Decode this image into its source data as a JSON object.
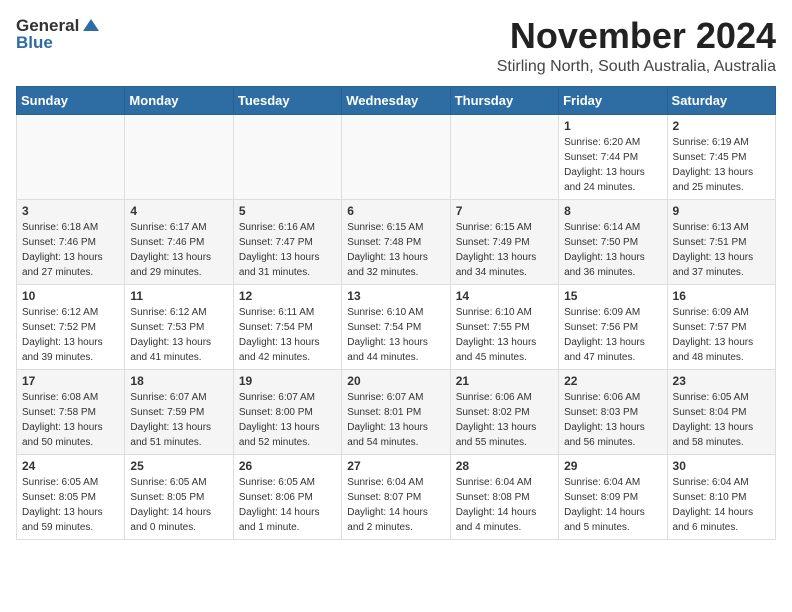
{
  "logo": {
    "general": "General",
    "blue": "Blue"
  },
  "header": {
    "title": "November 2024",
    "subtitle": "Stirling North, South Australia, Australia"
  },
  "weekdays": [
    "Sunday",
    "Monday",
    "Tuesday",
    "Wednesday",
    "Thursday",
    "Friday",
    "Saturday"
  ],
  "weeks": [
    [
      {
        "day": "",
        "info": ""
      },
      {
        "day": "",
        "info": ""
      },
      {
        "day": "",
        "info": ""
      },
      {
        "day": "",
        "info": ""
      },
      {
        "day": "",
        "info": ""
      },
      {
        "day": "1",
        "info": "Sunrise: 6:20 AM\nSunset: 7:44 PM\nDaylight: 13 hours\nand 24 minutes."
      },
      {
        "day": "2",
        "info": "Sunrise: 6:19 AM\nSunset: 7:45 PM\nDaylight: 13 hours\nand 25 minutes."
      }
    ],
    [
      {
        "day": "3",
        "info": "Sunrise: 6:18 AM\nSunset: 7:46 PM\nDaylight: 13 hours\nand 27 minutes."
      },
      {
        "day": "4",
        "info": "Sunrise: 6:17 AM\nSunset: 7:46 PM\nDaylight: 13 hours\nand 29 minutes."
      },
      {
        "day": "5",
        "info": "Sunrise: 6:16 AM\nSunset: 7:47 PM\nDaylight: 13 hours\nand 31 minutes."
      },
      {
        "day": "6",
        "info": "Sunrise: 6:15 AM\nSunset: 7:48 PM\nDaylight: 13 hours\nand 32 minutes."
      },
      {
        "day": "7",
        "info": "Sunrise: 6:15 AM\nSunset: 7:49 PM\nDaylight: 13 hours\nand 34 minutes."
      },
      {
        "day": "8",
        "info": "Sunrise: 6:14 AM\nSunset: 7:50 PM\nDaylight: 13 hours\nand 36 minutes."
      },
      {
        "day": "9",
        "info": "Sunrise: 6:13 AM\nSunset: 7:51 PM\nDaylight: 13 hours\nand 37 minutes."
      }
    ],
    [
      {
        "day": "10",
        "info": "Sunrise: 6:12 AM\nSunset: 7:52 PM\nDaylight: 13 hours\nand 39 minutes."
      },
      {
        "day": "11",
        "info": "Sunrise: 6:12 AM\nSunset: 7:53 PM\nDaylight: 13 hours\nand 41 minutes."
      },
      {
        "day": "12",
        "info": "Sunrise: 6:11 AM\nSunset: 7:54 PM\nDaylight: 13 hours\nand 42 minutes."
      },
      {
        "day": "13",
        "info": "Sunrise: 6:10 AM\nSunset: 7:54 PM\nDaylight: 13 hours\nand 44 minutes."
      },
      {
        "day": "14",
        "info": "Sunrise: 6:10 AM\nSunset: 7:55 PM\nDaylight: 13 hours\nand 45 minutes."
      },
      {
        "day": "15",
        "info": "Sunrise: 6:09 AM\nSunset: 7:56 PM\nDaylight: 13 hours\nand 47 minutes."
      },
      {
        "day": "16",
        "info": "Sunrise: 6:09 AM\nSunset: 7:57 PM\nDaylight: 13 hours\nand 48 minutes."
      }
    ],
    [
      {
        "day": "17",
        "info": "Sunrise: 6:08 AM\nSunset: 7:58 PM\nDaylight: 13 hours\nand 50 minutes."
      },
      {
        "day": "18",
        "info": "Sunrise: 6:07 AM\nSunset: 7:59 PM\nDaylight: 13 hours\nand 51 minutes."
      },
      {
        "day": "19",
        "info": "Sunrise: 6:07 AM\nSunset: 8:00 PM\nDaylight: 13 hours\nand 52 minutes."
      },
      {
        "day": "20",
        "info": "Sunrise: 6:07 AM\nSunset: 8:01 PM\nDaylight: 13 hours\nand 54 minutes."
      },
      {
        "day": "21",
        "info": "Sunrise: 6:06 AM\nSunset: 8:02 PM\nDaylight: 13 hours\nand 55 minutes."
      },
      {
        "day": "22",
        "info": "Sunrise: 6:06 AM\nSunset: 8:03 PM\nDaylight: 13 hours\nand 56 minutes."
      },
      {
        "day": "23",
        "info": "Sunrise: 6:05 AM\nSunset: 8:04 PM\nDaylight: 13 hours\nand 58 minutes."
      }
    ],
    [
      {
        "day": "24",
        "info": "Sunrise: 6:05 AM\nSunset: 8:05 PM\nDaylight: 13 hours\nand 59 minutes."
      },
      {
        "day": "25",
        "info": "Sunrise: 6:05 AM\nSunset: 8:05 PM\nDaylight: 14 hours\nand 0 minutes."
      },
      {
        "day": "26",
        "info": "Sunrise: 6:05 AM\nSunset: 8:06 PM\nDaylight: 14 hours\nand 1 minute."
      },
      {
        "day": "27",
        "info": "Sunrise: 6:04 AM\nSunset: 8:07 PM\nDaylight: 14 hours\nand 2 minutes."
      },
      {
        "day": "28",
        "info": "Sunrise: 6:04 AM\nSunset: 8:08 PM\nDaylight: 14 hours\nand 4 minutes."
      },
      {
        "day": "29",
        "info": "Sunrise: 6:04 AM\nSunset: 8:09 PM\nDaylight: 14 hours\nand 5 minutes."
      },
      {
        "day": "30",
        "info": "Sunrise: 6:04 AM\nSunset: 8:10 PM\nDaylight: 14 hours\nand 6 minutes."
      }
    ]
  ]
}
